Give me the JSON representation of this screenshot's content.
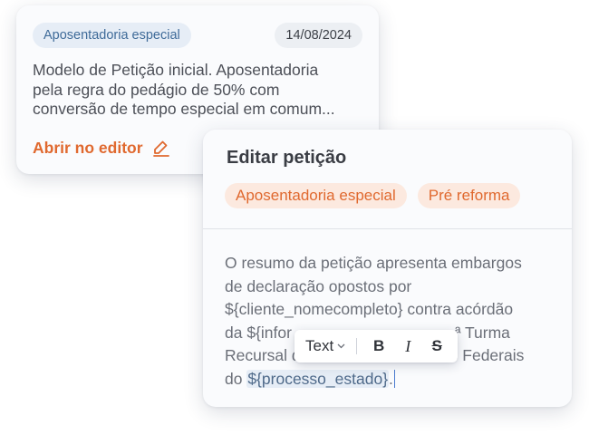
{
  "petition_card": {
    "tag": "Aposentadoria especial",
    "date": "14/08/2024",
    "summary_lines": [
      "Modelo de Petição inicial. Aposentadoria",
      "pela regra do pedágio de 50% com",
      "conversão de tempo especial em comum..."
    ],
    "open_editor_label": "Abrir no editor"
  },
  "editor": {
    "title": "Editar petição",
    "tags": [
      "Aposentadoria especial",
      "Pré reforma"
    ],
    "body": {
      "line1": "O resumo da petição apresenta embargos",
      "line2": "de declaração opostos por",
      "line3": "${cliente_nomecompleto} contra acórdão",
      "line4": "da ${infor",
      "line4_tail": "ª Turma",
      "line5": "Recursal d",
      "line5_tail": "s Federais",
      "line6_prefix": "do ",
      "line6_var": "${processo_estado}",
      "line6_suffix": "."
    }
  },
  "toolbar": {
    "format_select": "Text",
    "bold_label": "B",
    "italic_label": "I",
    "strike_label": "S"
  },
  "colors": {
    "accent_orange": "#e0692f",
    "tag_blue_bg": "#e6edf6",
    "tag_blue_text": "#3f6b99",
    "tag_orange_bg": "#fce9df"
  }
}
